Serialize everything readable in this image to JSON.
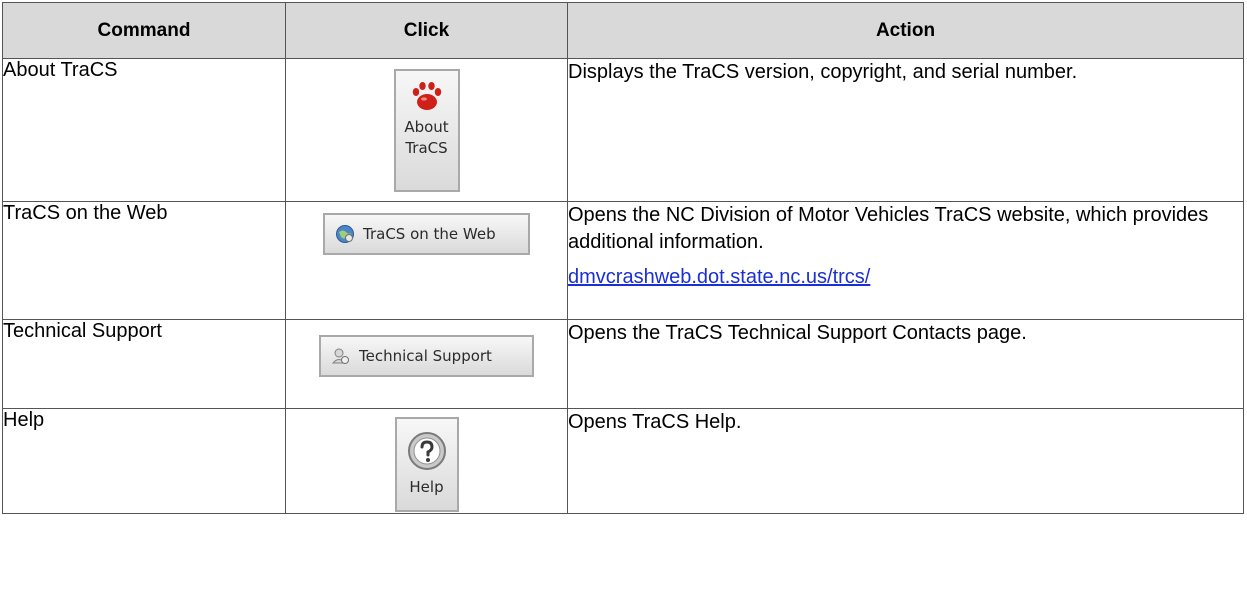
{
  "header": {
    "command": "Command",
    "click": "Click",
    "action": "Action"
  },
  "rows": [
    {
      "command": "About TraCS",
      "button": {
        "line1": "About",
        "line2": "TraCS",
        "icon": "paw-icon"
      },
      "action": "Displays the TraCS version, copyright, and serial number."
    },
    {
      "command": "TraCS on the Web",
      "button": {
        "label": "TraCS on the Web",
        "icon": "globe-icon"
      },
      "action": "Opens the NC Division of Motor Vehicles TraCS website, which provides additional information.",
      "link": "dmvcrashweb.dot.state.nc.us/trcs/"
    },
    {
      "command": "Technical Support",
      "button": {
        "label": "Technical Support",
        "icon": "support-icon"
      },
      "action": "Opens the TraCS Technical Support Contacts page."
    },
    {
      "command": "Help",
      "button": {
        "label": "Help",
        "icon": "help-icon"
      },
      "action": "Opens TraCS Help."
    }
  ],
  "colors": {
    "header_bg": "#d9d9d9",
    "link": "#1a2fd4",
    "paw": "#d0201a"
  }
}
